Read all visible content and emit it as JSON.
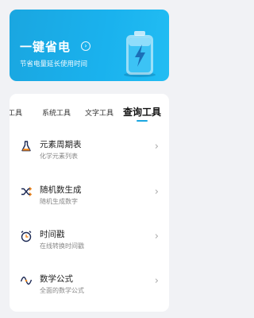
{
  "banner": {
    "title": "一键省电",
    "subtitle": "节省电量延长使用时间",
    "arrow": "›",
    "color": "#1aa6e0"
  },
  "tabs": [
    {
      "label": "工具",
      "active": false
    },
    {
      "label": "系统工具",
      "active": false
    },
    {
      "label": "文字工具",
      "active": false
    },
    {
      "label": "查询工具",
      "active": true
    }
  ],
  "items": [
    {
      "title": "元素周期表",
      "subtitle": "化学元素列表",
      "icon": "flask-icon"
    },
    {
      "title": "随机数生成",
      "subtitle": "随机生成数字",
      "icon": "shuffle-icon"
    },
    {
      "title": "时间戳",
      "subtitle": "在线转换时间戳",
      "icon": "alarm-clock-icon"
    },
    {
      "title": "数学公式",
      "subtitle": "全面的数学公式",
      "icon": "wave-icon"
    }
  ],
  "chevron": "›"
}
